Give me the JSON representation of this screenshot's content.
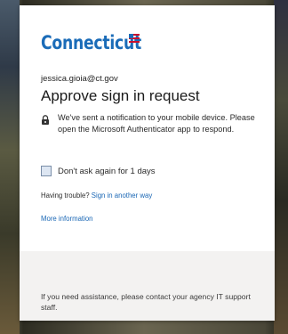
{
  "brand": {
    "name": "Connecticut",
    "color": "#1b6cb8"
  },
  "account": {
    "email": "jessica.gioia@ct.gov"
  },
  "page": {
    "title": "Approve sign in request",
    "notice": "We've sent a notification to your mobile device. Please open the Microsoft Authenticator app to respond."
  },
  "options": {
    "dont_ask_label": "Don't ask again for 1 days",
    "dont_ask_checked": false
  },
  "help": {
    "trouble_prefix": "Having trouble?",
    "sign_in_another_way": "Sign in another way",
    "more_information": "More information"
  },
  "footer": {
    "assistance_text": "If you need assistance, please contact your agency IT support staff."
  },
  "icons": {
    "logo_flag": "flag-icon",
    "lock": "lock-icon"
  },
  "colors": {
    "link": "#1a67b5",
    "footer_bg": "#f3f2f1"
  }
}
